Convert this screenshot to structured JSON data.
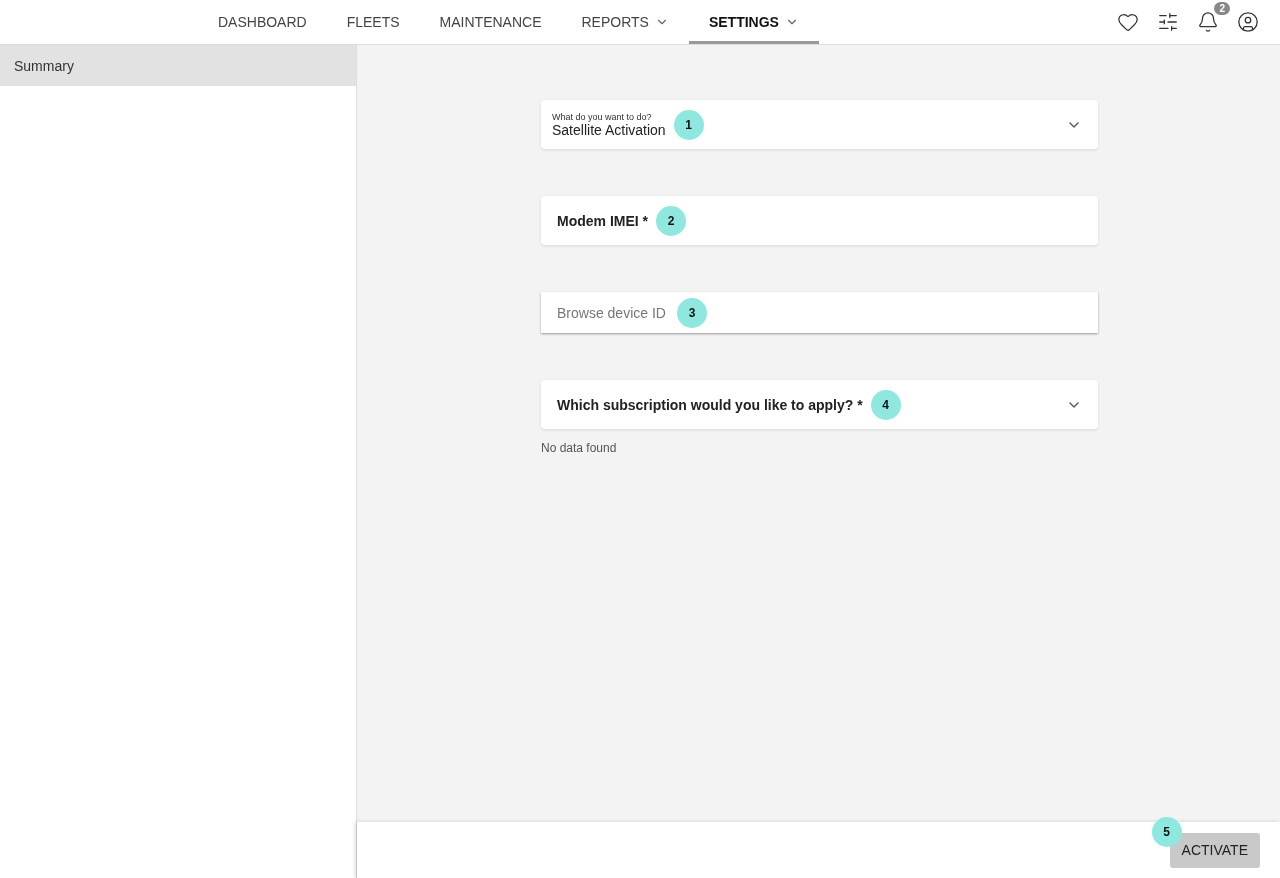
{
  "nav": {
    "tabs": [
      {
        "label": "DASHBOARD",
        "selected": false,
        "has_menu": false
      },
      {
        "label": "FLEETS",
        "selected": false,
        "has_menu": false
      },
      {
        "label": "MAINTENANCE",
        "selected": false,
        "has_menu": false
      },
      {
        "label": "REPORTS",
        "selected": false,
        "has_menu": true
      },
      {
        "label": "SETTINGS",
        "selected": true,
        "has_menu": true
      }
    ],
    "notification_count": "2"
  },
  "sidebar": {
    "items": [
      {
        "label": "Summary",
        "selected": true
      }
    ]
  },
  "form": {
    "fields": [
      {
        "kind": "select",
        "label": "What do you want to do?",
        "value": "Satellite Activation",
        "step": "1"
      },
      {
        "kind": "input",
        "label": "Modem IMEI *",
        "step": "2"
      },
      {
        "kind": "search",
        "placeholder": "Browse device ID",
        "step": "3"
      },
      {
        "kind": "question",
        "label": "Which subscription would you like to apply? *",
        "step": "4",
        "note": "No data found"
      }
    ]
  },
  "footer": {
    "button": "ACTIVATE",
    "step": "5"
  }
}
